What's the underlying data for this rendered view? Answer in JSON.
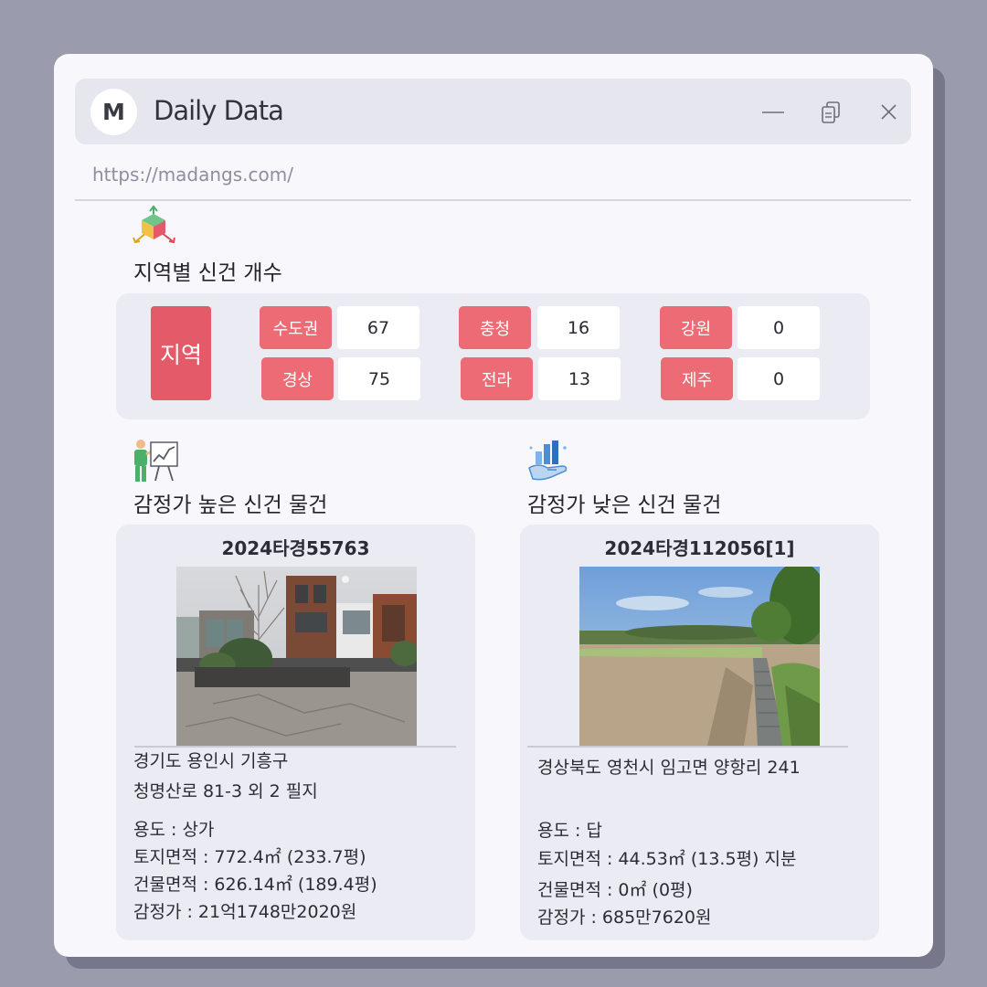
{
  "window": {
    "logo_letter": "M",
    "title": "Daily Data",
    "url": "https://madangs.com/"
  },
  "region_section": {
    "title": "지역별 신건 개수",
    "label": "지역",
    "regions": [
      {
        "name": "수도권",
        "count": "67"
      },
      {
        "name": "경상",
        "count": "75"
      },
      {
        "name": "충청",
        "count": "16"
      },
      {
        "name": "전라",
        "count": "13"
      },
      {
        "name": "강원",
        "count": "0"
      },
      {
        "name": "제주",
        "count": "0"
      }
    ]
  },
  "high_section": {
    "title": "감정가 높은 신건 물건",
    "case_id": "2024타경55763",
    "address_line1": "경기도 용인시 기흥구",
    "address_line2": "청명산로 81-3 외 2 필지",
    "usage": "용도 : 상가",
    "land_area": "토지면적 : 772.4㎡ (233.7평)",
    "building_area": "건물면적 : 626.14㎡ (189.4평)",
    "appraisal": "감정가 : 21억1748만2020원"
  },
  "low_section": {
    "title": "감정가 낮은 신건 물건",
    "case_id": "2024타경112056[1]",
    "address_line1": "경상북도 영천시 임고면 양항리 241",
    "usage": "용도 : 답",
    "land_area": "토지면적 : 44.53㎡ (13.5평) 지분",
    "building_area": "건물면적 : 0㎡ (0평)",
    "appraisal": "감정가 : 685만7620원"
  },
  "icons": {
    "region": "cube-arrows-icon",
    "high": "presentation-chart-icon",
    "low": "hand-bar-chart-icon",
    "minimize": "minimize-icon",
    "restore": "restore-icon",
    "close": "close-icon"
  },
  "colors": {
    "accent": "#ed6b74",
    "accent_dark": "#e35b68",
    "panel": "#ebebf4",
    "window": "#f7f7fc",
    "titlebar": "#e5e6ee",
    "backdrop": "#9a9bad"
  }
}
